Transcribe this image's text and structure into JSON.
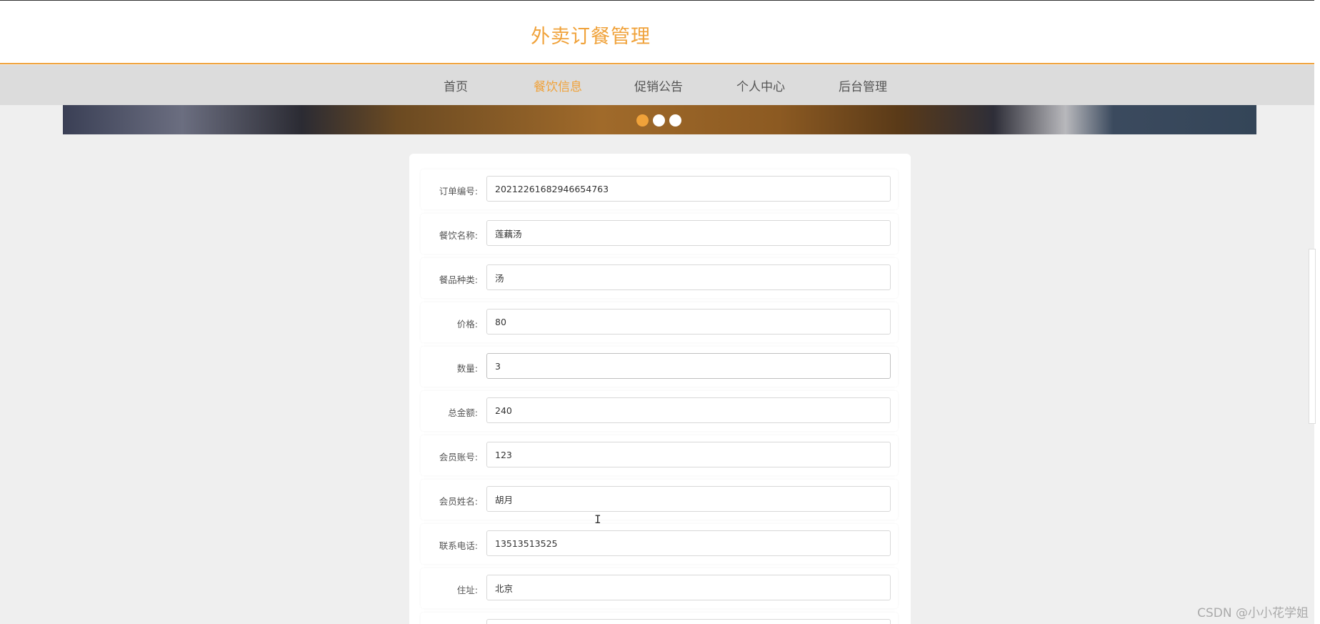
{
  "header": {
    "title": "外卖订餐管理"
  },
  "nav": {
    "items": [
      {
        "label": "首页"
      },
      {
        "label": "餐饮信息"
      },
      {
        "label": "促销公告"
      },
      {
        "label": "个人中心"
      },
      {
        "label": "后台管理"
      }
    ],
    "active_index": 1
  },
  "banner": {
    "dot_count": 3,
    "active_dot": 0
  },
  "form": {
    "fields": [
      {
        "label": "订单编号:",
        "value": "20212261682946654763"
      },
      {
        "label": "餐饮名称:",
        "value": "莲藕汤"
      },
      {
        "label": "餐品种类:",
        "value": "汤"
      },
      {
        "label": "价格:",
        "value": "80"
      },
      {
        "label": "数量:",
        "value": "3"
      },
      {
        "label": "总金额:",
        "value": "240"
      },
      {
        "label": "会员账号:",
        "value": "123"
      },
      {
        "label": "会员姓名:",
        "value": "胡月"
      },
      {
        "label": "联系电话:",
        "value": "13513513525"
      },
      {
        "label": "住址:",
        "value": "北京"
      }
    ]
  },
  "watermark": "CSDN @小小花学姐",
  "colors": {
    "accent": "#f0a23a",
    "nav_bg": "#dcdcdc",
    "page_bg": "#efefef"
  }
}
